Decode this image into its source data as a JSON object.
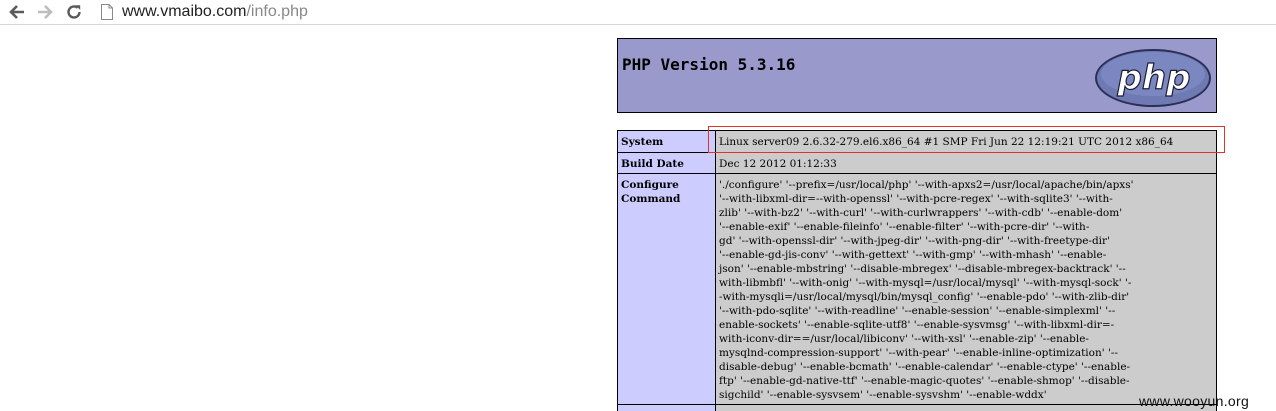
{
  "browser": {
    "url_domain": "www.vmaibo.com",
    "url_path": "/info.php"
  },
  "header": {
    "title": "PHP Version 5.3.16",
    "logo_text": "php"
  },
  "table": {
    "rows": [
      {
        "label": "System",
        "value": "Linux server09 2.6.32-279.el6.x86_64 #1 SMP Fri Jun 22 12:19:21 UTC 2012 x86_64"
      },
      {
        "label": "Build Date",
        "value": "Dec 12 2012 01:12:33"
      }
    ],
    "configure": {
      "label_line1": "Configure",
      "label_line2": "Command",
      "lines": [
        "'./configure' '--prefix=/usr/local/php' '--with-apxs2=/usr/local/apache/bin/apxs'",
        "'--with-libxml-dir=--with-openssl' '--with-pcre-regex' '--with-sqlite3' '--with-",
        "zlib' '--with-bz2' '--with-curl' '--with-curlwrappers' '--with-cdb' '--enable-dom'",
        "'--enable-exif' '--enable-fileinfo' '--enable-filter' '--with-pcre-dir' '--with-",
        "gd' '--with-openssl-dir' '--with-jpeg-dir' '--with-png-dir' '--with-freetype-dir'",
        "'--enable-gd-jis-conv' '--with-gettext' '--with-gmp' '--with-mhash' '--enable-",
        "json' '--enable-mbstring' '--disable-mbregex' '--disable-mbregex-backtrack' '--",
        "with-libmbfl' '--with-onig' '--with-mysql=/usr/local/mysql' '--with-mysql-sock' '-",
        "-with-mysqli=/usr/local/mysql/bin/mysql_config' '--enable-pdo' '--with-zlib-dir'",
        "'--with-pdo-sqlite' '--with-readline' '--enable-session' '--enable-simplexml' '--",
        "enable-sockets' '--enable-sqlite-utf8' '--enable-sysvmsg' '--with-libxml-dir=-",
        "with-iconv-dir==/usr/local/libiconv' '--with-xsl' '--enable-zip' '--enable-",
        "mysqlnd-compression-support' '--with-pear' '--enable-inline-optimization' '--",
        "disable-debug' '--enable-bcmath' '--enable-calendar' '--enable-ctype' '--enable-",
        "ftp' '--enable-gd-native-ttf' '--enable-magic-quotes' '--enable-shmop' '--disable-",
        "sigchild' '--enable-sysvsem' '--enable-sysvshm' '--enable-wddx'"
      ]
    }
  },
  "watermark": "www.wooyun.org",
  "colors": {
    "header_bg": "#9999cc",
    "label_bg": "#ccccff",
    "value_bg": "#cccccc",
    "highlight": "#e0322d"
  }
}
